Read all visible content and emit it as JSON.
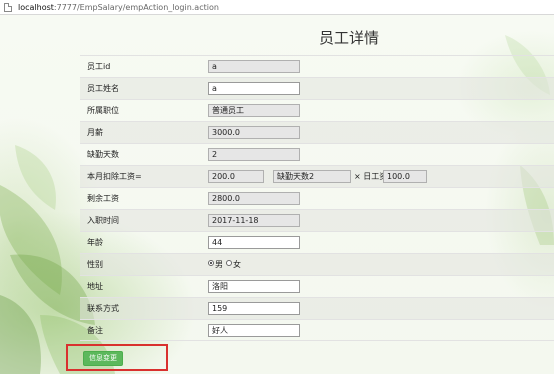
{
  "browser": {
    "url_host": "localhost",
    "url_rest": ":7777/EmpSalary/empAction_login.action"
  },
  "page": {
    "title": "员工详情"
  },
  "form": {
    "emp_id": {
      "label": "员工id",
      "value": "a"
    },
    "emp_name": {
      "label": "员工姓名",
      "value": "a"
    },
    "position": {
      "label": "所属职位",
      "value": "普通员工"
    },
    "monthly_salary": {
      "label": "月薪",
      "value": "3000.0"
    },
    "absent_days": {
      "label": "缺勤天数",
      "value": "2"
    },
    "deduction": {
      "label": "本月扣除工资=",
      "value": "200.0",
      "absent_text": "缺勤天数2",
      "times_text": "× 日工资",
      "daily_value": "100.0"
    },
    "remaining_salary": {
      "label": "剩余工资",
      "value": "2800.0"
    },
    "hire_date": {
      "label": "入职时间",
      "value": "2017-11-18"
    },
    "age": {
      "label": "年龄",
      "value": "44"
    },
    "gender": {
      "label": "性别",
      "male": "男",
      "female": "女",
      "selected": "男"
    },
    "address": {
      "label": "地址",
      "value": "洛阳"
    },
    "contact": {
      "label": "联系方式",
      "value": "159"
    },
    "remark": {
      "label": "备注",
      "value": "好人"
    }
  },
  "submit_label": "信息变更",
  "colors": {
    "button": "#5cb85c",
    "highlight": "#d9302e"
  }
}
